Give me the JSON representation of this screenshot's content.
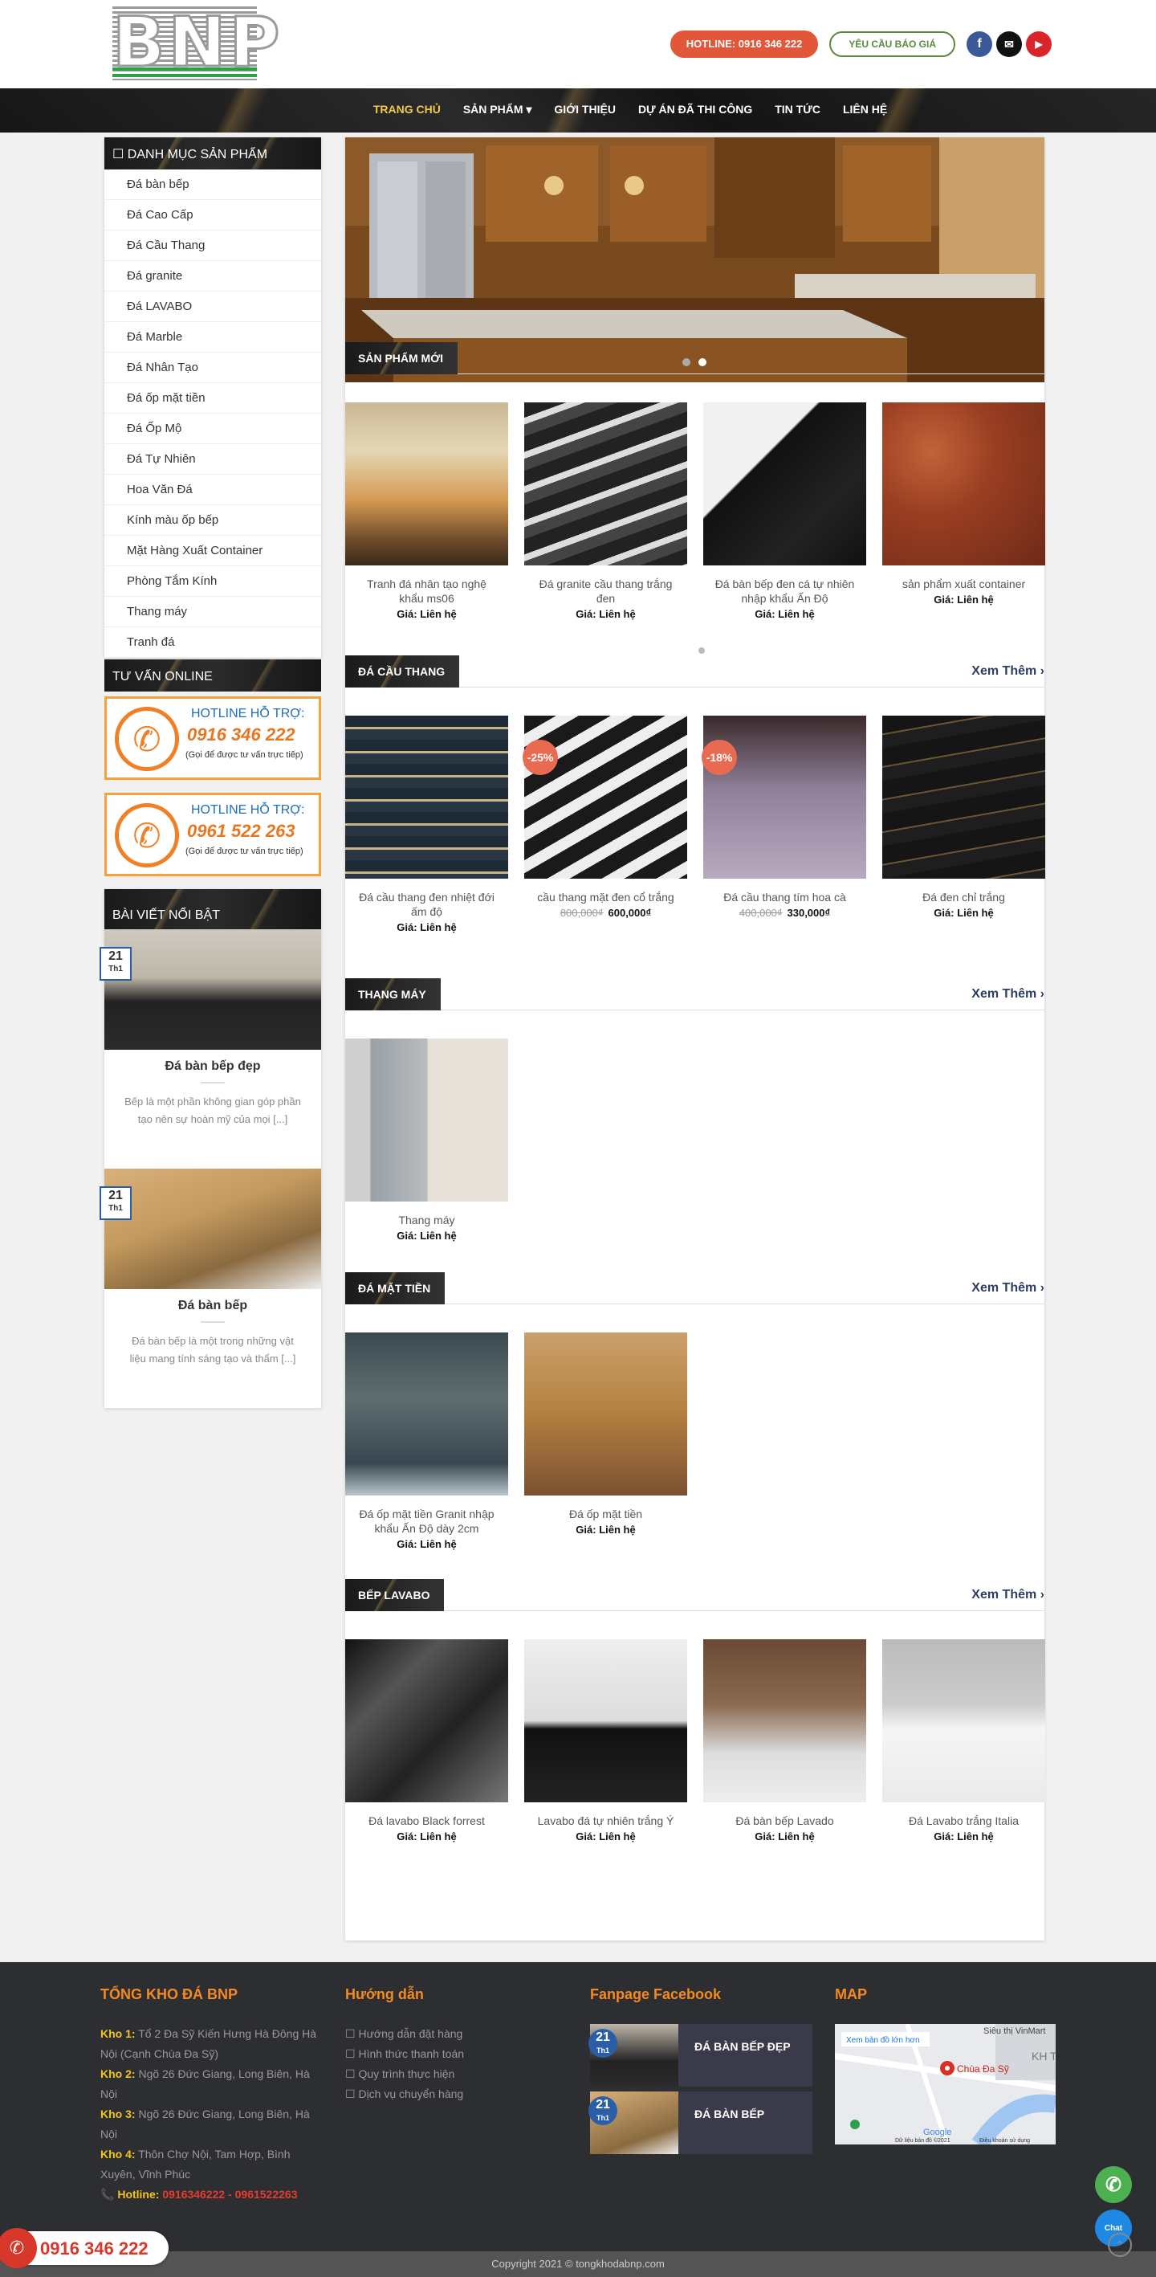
{
  "header": {
    "logo_text": "BNP",
    "hotline": "HOTLINE: 0916 346 222",
    "quote_button": "YÊU CẦU BÁO GIÁ",
    "social": [
      "facebook-icon",
      "mail-icon",
      "youtube-icon"
    ]
  },
  "nav": [
    "TRANG CHỦ",
    "SẢN PHẨM",
    "GIỚI THIỆU",
    "DỰ ÁN ĐÃ THI CÔNG",
    "TIN TỨC",
    "LIÊN HỆ"
  ],
  "sidebar": {
    "cat_title": "DANH MỤC SẢN PHẨM",
    "cats": [
      "Đá bàn bếp",
      "Đá Cao Cấp",
      "Đá Cầu Thang",
      "Đá granite",
      "Đá LAVABO",
      "Đá Marble",
      "Đá Nhân Tạo",
      "Đá ốp mặt tiền",
      "Đá Ốp Mộ",
      "Đá Tự Nhiên",
      "Hoa Văn Đá",
      "Kính màu ốp bếp",
      "Mặt Hàng Xuất Container",
      "Phòng Tắm Kính",
      "Thang máy",
      "Tranh đá"
    ],
    "consult_title": "TƯ VẤN ONLINE",
    "hotlines": [
      {
        "label": "HOTLINE HỖ TRỢ:",
        "number": "0916 346 222",
        "note": "(Gọi để được tư vấn trực tiếp)"
      },
      {
        "label": "HOTLINE HỖ TRỢ:",
        "number": "0961 522 263",
        "note": "(Gọi để được tư vấn trực tiếp)"
      }
    ],
    "posts_title": "BÀI VIẾT NỔI BẬT",
    "posts": [
      {
        "day": "21",
        "month": "Th1",
        "title": "Đá bàn bếp đẹp",
        "excerpt": "Bếp là một phần không gian góp phần tạo nên sự hoàn mỹ của mọi [...]"
      },
      {
        "day": "21",
        "month": "Th1",
        "title": "Đá bàn bếp",
        "excerpt": "Đá bàn bếp là một trong những vật liệu mang tính sáng tạo và thẩm [...]"
      }
    ]
  },
  "sections": [
    {
      "title": "SẢN PHẨM MỚI",
      "more": "",
      "products": [
        {
          "name": "Tranh đá nhân tạo nghệ khẩu ms06",
          "price": "Giá: Liên hệ"
        },
        {
          "name": "Đá granite cầu thang trắng đen",
          "price": "Giá: Liên hệ"
        },
        {
          "name": "Đá bàn bếp đen cá tự nhiên nhập khẩu Ấn Độ",
          "price": "Giá: Liên hệ"
        },
        {
          "name": "sản phẩm xuất container",
          "price": "Giá: Liên hệ"
        }
      ]
    },
    {
      "title": "ĐÁ CẦU THANG",
      "more": "Xem Thêm",
      "products": [
        {
          "name": "Đá cầu thang đen nhiệt đới ấm độ",
          "price": "Giá: Liên hệ"
        },
        {
          "name": "cầu thang mặt đen cổ trắng",
          "old": "800,000₫",
          "new": "600,000₫",
          "badge": "-25%"
        },
        {
          "name": "Đá cầu thang tím hoa cà",
          "old": "400,000₫",
          "new": "330,000₫",
          "badge": "-18%"
        },
        {
          "name": "Đá đen chỉ trắng",
          "price": "Giá: Liên hệ"
        }
      ]
    },
    {
      "title": "THANG MÁY",
      "more": "Xem Thêm",
      "products": [
        {
          "name": "Thang máy",
          "price": "Giá: Liên hệ"
        }
      ]
    },
    {
      "title": "ĐÁ MẶT TIỀN",
      "more": "Xem Thêm",
      "products": [
        {
          "name": "Đá ốp mặt tiền Granit nhập khẩu Ấn Độ dày 2cm",
          "price": "Giá: Liên hệ"
        },
        {
          "name": "Đá ốp mặt tiền",
          "price": "Giá: Liên hệ"
        }
      ]
    },
    {
      "title": "BẾP LAVABO",
      "more": "Xem Thêm",
      "products": [
        {
          "name": "Đá lavabo Black forrest",
          "price": "Giá: Liên hệ"
        },
        {
          "name": "Lavabo đá tự nhiên trắng Ý",
          "price": "Giá: Liên hệ"
        },
        {
          "name": "Đá bàn bếp Lavado",
          "price": "Giá: Liên hệ"
        },
        {
          "name": "Đá Lavabo trắng Italia",
          "price": "Giá: Liên hệ"
        }
      ]
    }
  ],
  "footer": {
    "col1_title": "TỔNG KHO ĐÁ BNP",
    "stores": [
      {
        "label": "Kho 1:",
        "addr": "Tổ 2 Đa Sỹ Kiến Hưng Hà Đông Hà Nội (Cạnh Chùa Đa Sỹ)"
      },
      {
        "label": "Kho 2:",
        "addr": "Ngõ 26 Đức Giang, Long Biên, Hà Nội"
      },
      {
        "label": "Kho 3:",
        "addr": "Ngõ 26 Đức Giang, Long Biên, Hà Nội"
      },
      {
        "label": "Kho 4:",
        "addr": "Thôn Chợ Nội, Tam Hợp, Bình Xuyên, Vĩnh Phúc"
      }
    ],
    "hotline_label": "Hotline:",
    "hotline_numbers": "0916346222 - 0961522263",
    "col2_title": "Hướng dẫn",
    "guides": [
      "Hướng dẫn đặt hàng",
      "Hình thức thanh toán",
      "Quy trình thực hiện",
      "Dịch vụ chuyển hàng"
    ],
    "col3_title": "Fanpage Facebook",
    "fb_posts": [
      {
        "day": "21",
        "month": "Th1",
        "title": "ĐÁ BÀN BẾP ĐẸP"
      },
      {
        "day": "21",
        "month": "Th1",
        "title": "ĐÁ BÀN BẾP"
      }
    ],
    "col4_title": "MAP",
    "map": {
      "link": "Xem bản đồ lớn hơn",
      "place": "Chùa Đa Sỹ",
      "store": "Siêu thị VinMart",
      "area": "KH THI",
      "brand": "Google",
      "copyright": "Dữ liệu bản đồ ©2021",
      "terms": "Điều khoản sử dụng"
    },
    "copyright": "Copyright 2021 © tongkhodabnp.com"
  },
  "callbar": {
    "number": "0916 346 222"
  },
  "fab_labels": {
    "chat": "Chat"
  }
}
